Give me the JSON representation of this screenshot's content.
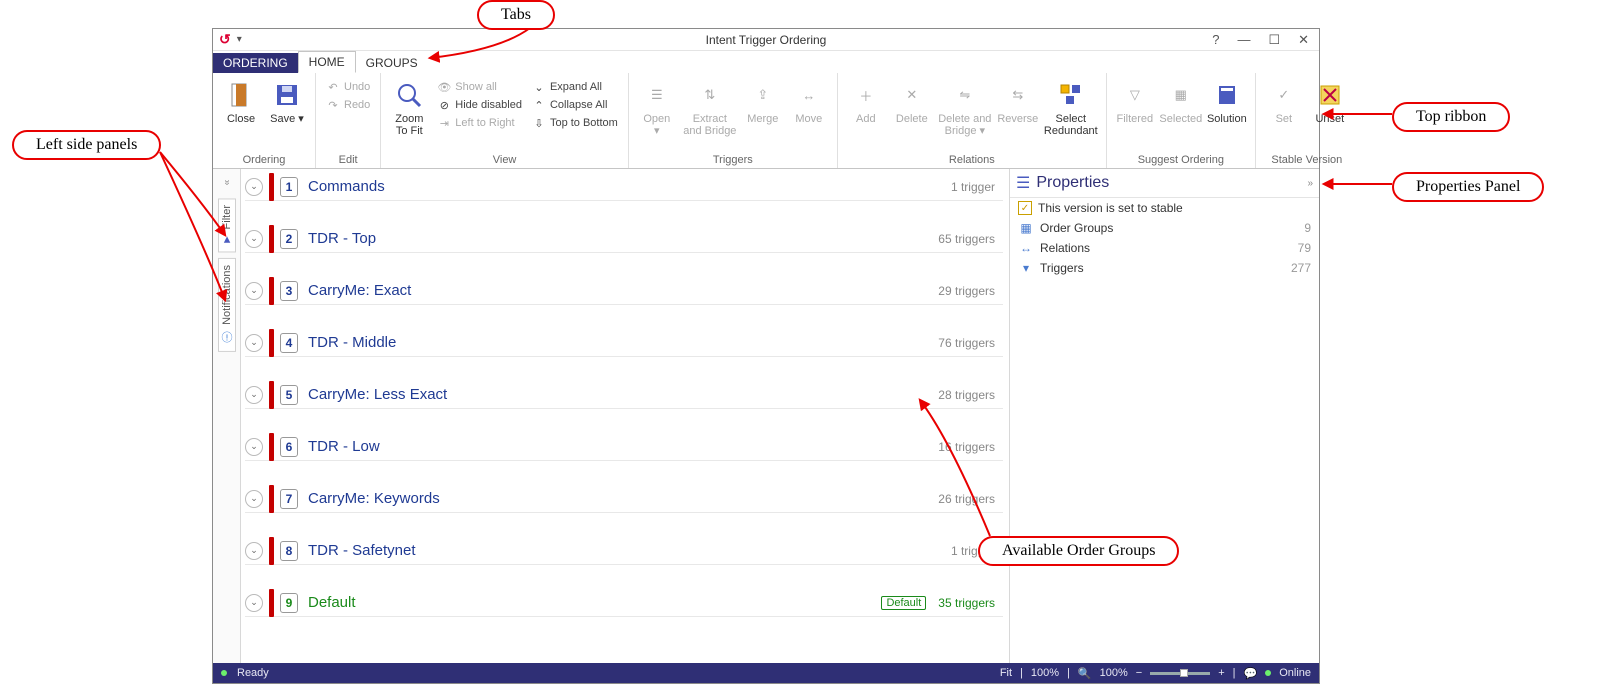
{
  "title": "Intent Trigger Ordering",
  "tabs": {
    "file": "ORDERING",
    "items": [
      "HOME",
      "GROUPS"
    ],
    "activeIndex": 0
  },
  "ribbon": {
    "groups": {
      "ordering": {
        "label": "Ordering",
        "close": "Close",
        "save": "Save"
      },
      "edit": {
        "label": "Edit",
        "undo": "Undo",
        "redo": "Redo"
      },
      "view": {
        "label": "View",
        "zoom": "Zoom To Fit",
        "showAll": "Show all",
        "hideDisabled": "Hide disabled",
        "ltr": "Left to Right",
        "expandAll": "Expand All",
        "collapseAll": "Collapse All",
        "ttb": "Top to Bottom"
      },
      "triggers": {
        "label": "Triggers",
        "open": "Open",
        "extract": "Extract and Bridge",
        "merge": "Merge",
        "move": "Move"
      },
      "relations": {
        "label": "Relations",
        "add": "Add",
        "delete": "Delete",
        "deleteBridge": "Delete and Bridge",
        "reverse": "Reverse",
        "selectRedundant": "Select Redundant"
      },
      "suggest": {
        "label": "Suggest Ordering",
        "filtered": "Filtered",
        "selected": "Selected",
        "solution": "Solution"
      },
      "stable": {
        "label": "Stable Version",
        "set": "Set",
        "unset": "Unset"
      }
    }
  },
  "leftrail": {
    "filter": "Filter",
    "notifications": "Notifications"
  },
  "orderGroups": [
    {
      "n": "1",
      "name": "Commands",
      "count": "1 trigger",
      "default": false
    },
    {
      "n": "2",
      "name": "TDR - Top",
      "count": "65 triggers",
      "default": false
    },
    {
      "n": "3",
      "name": "CarryMe: Exact",
      "count": "29 triggers",
      "default": false
    },
    {
      "n": "4",
      "name": "TDR - Middle",
      "count": "76 triggers",
      "default": false
    },
    {
      "n": "5",
      "name": "CarryMe: Less Exact",
      "count": "28 triggers",
      "default": false
    },
    {
      "n": "6",
      "name": "TDR - Low",
      "count": "16 triggers",
      "default": false
    },
    {
      "n": "7",
      "name": "CarryMe: Keywords",
      "count": "26 triggers",
      "default": false
    },
    {
      "n": "8",
      "name": "TDR - Safetynet",
      "count": "1 trigger",
      "default": false
    },
    {
      "n": "9",
      "name": "Default",
      "count": "35 triggers",
      "default": true,
      "badge": "Default"
    }
  ],
  "properties": {
    "title": "Properties",
    "stableMsg": "This version is set to stable",
    "rows": [
      {
        "label": "Order Groups",
        "value": "9"
      },
      {
        "label": "Relations",
        "value": "79"
      },
      {
        "label": "Triggers",
        "value": "277"
      }
    ]
  },
  "status": {
    "ready": "Ready",
    "fit1": "Fit",
    "pct1": "100%",
    "pct2": "100%",
    "online": "Online"
  },
  "annotations": {
    "tabs": "Tabs",
    "leftPanels": "Left side panels",
    "ribbon": "Top ribbon",
    "propsPanel": "Properties Panel",
    "orderGroups": "Available Order Groups"
  }
}
